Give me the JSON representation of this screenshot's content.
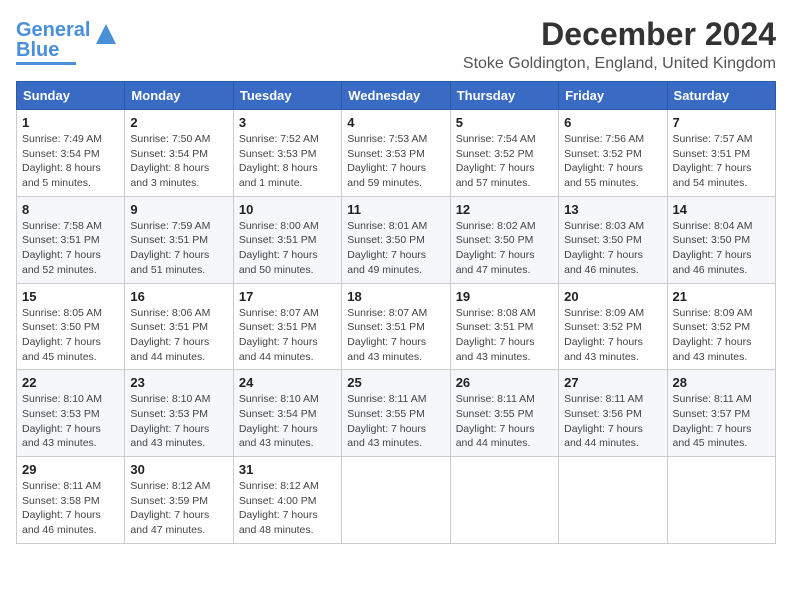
{
  "logo": {
    "part1": "General",
    "part2": "Blue"
  },
  "title": "December 2024",
  "subtitle": "Stoke Goldington, England, United Kingdom",
  "headers": [
    "Sunday",
    "Monday",
    "Tuesday",
    "Wednesday",
    "Thursday",
    "Friday",
    "Saturday"
  ],
  "weeks": [
    [
      {
        "day": "1",
        "sunrise": "Sunrise: 7:49 AM",
        "sunset": "Sunset: 3:54 PM",
        "daylight": "Daylight: 8 hours and 5 minutes."
      },
      {
        "day": "2",
        "sunrise": "Sunrise: 7:50 AM",
        "sunset": "Sunset: 3:54 PM",
        "daylight": "Daylight: 8 hours and 3 minutes."
      },
      {
        "day": "3",
        "sunrise": "Sunrise: 7:52 AM",
        "sunset": "Sunset: 3:53 PM",
        "daylight": "Daylight: 8 hours and 1 minute."
      },
      {
        "day": "4",
        "sunrise": "Sunrise: 7:53 AM",
        "sunset": "Sunset: 3:53 PM",
        "daylight": "Daylight: 7 hours and 59 minutes."
      },
      {
        "day": "5",
        "sunrise": "Sunrise: 7:54 AM",
        "sunset": "Sunset: 3:52 PM",
        "daylight": "Daylight: 7 hours and 57 minutes."
      },
      {
        "day": "6",
        "sunrise": "Sunrise: 7:56 AM",
        "sunset": "Sunset: 3:52 PM",
        "daylight": "Daylight: 7 hours and 55 minutes."
      },
      {
        "day": "7",
        "sunrise": "Sunrise: 7:57 AM",
        "sunset": "Sunset: 3:51 PM",
        "daylight": "Daylight: 7 hours and 54 minutes."
      }
    ],
    [
      {
        "day": "8",
        "sunrise": "Sunrise: 7:58 AM",
        "sunset": "Sunset: 3:51 PM",
        "daylight": "Daylight: 7 hours and 52 minutes."
      },
      {
        "day": "9",
        "sunrise": "Sunrise: 7:59 AM",
        "sunset": "Sunset: 3:51 PM",
        "daylight": "Daylight: 7 hours and 51 minutes."
      },
      {
        "day": "10",
        "sunrise": "Sunrise: 8:00 AM",
        "sunset": "Sunset: 3:51 PM",
        "daylight": "Daylight: 7 hours and 50 minutes."
      },
      {
        "day": "11",
        "sunrise": "Sunrise: 8:01 AM",
        "sunset": "Sunset: 3:50 PM",
        "daylight": "Daylight: 7 hours and 49 minutes."
      },
      {
        "day": "12",
        "sunrise": "Sunrise: 8:02 AM",
        "sunset": "Sunset: 3:50 PM",
        "daylight": "Daylight: 7 hours and 47 minutes."
      },
      {
        "day": "13",
        "sunrise": "Sunrise: 8:03 AM",
        "sunset": "Sunset: 3:50 PM",
        "daylight": "Daylight: 7 hours and 46 minutes."
      },
      {
        "day": "14",
        "sunrise": "Sunrise: 8:04 AM",
        "sunset": "Sunset: 3:50 PM",
        "daylight": "Daylight: 7 hours and 46 minutes."
      }
    ],
    [
      {
        "day": "15",
        "sunrise": "Sunrise: 8:05 AM",
        "sunset": "Sunset: 3:50 PM",
        "daylight": "Daylight: 7 hours and 45 minutes."
      },
      {
        "day": "16",
        "sunrise": "Sunrise: 8:06 AM",
        "sunset": "Sunset: 3:51 PM",
        "daylight": "Daylight: 7 hours and 44 minutes."
      },
      {
        "day": "17",
        "sunrise": "Sunrise: 8:07 AM",
        "sunset": "Sunset: 3:51 PM",
        "daylight": "Daylight: 7 hours and 44 minutes."
      },
      {
        "day": "18",
        "sunrise": "Sunrise: 8:07 AM",
        "sunset": "Sunset: 3:51 PM",
        "daylight": "Daylight: 7 hours and 43 minutes."
      },
      {
        "day": "19",
        "sunrise": "Sunrise: 8:08 AM",
        "sunset": "Sunset: 3:51 PM",
        "daylight": "Daylight: 7 hours and 43 minutes."
      },
      {
        "day": "20",
        "sunrise": "Sunrise: 8:09 AM",
        "sunset": "Sunset: 3:52 PM",
        "daylight": "Daylight: 7 hours and 43 minutes."
      },
      {
        "day": "21",
        "sunrise": "Sunrise: 8:09 AM",
        "sunset": "Sunset: 3:52 PM",
        "daylight": "Daylight: 7 hours and 43 minutes."
      }
    ],
    [
      {
        "day": "22",
        "sunrise": "Sunrise: 8:10 AM",
        "sunset": "Sunset: 3:53 PM",
        "daylight": "Daylight: 7 hours and 43 minutes."
      },
      {
        "day": "23",
        "sunrise": "Sunrise: 8:10 AM",
        "sunset": "Sunset: 3:53 PM",
        "daylight": "Daylight: 7 hours and 43 minutes."
      },
      {
        "day": "24",
        "sunrise": "Sunrise: 8:10 AM",
        "sunset": "Sunset: 3:54 PM",
        "daylight": "Daylight: 7 hours and 43 minutes."
      },
      {
        "day": "25",
        "sunrise": "Sunrise: 8:11 AM",
        "sunset": "Sunset: 3:55 PM",
        "daylight": "Daylight: 7 hours and 43 minutes."
      },
      {
        "day": "26",
        "sunrise": "Sunrise: 8:11 AM",
        "sunset": "Sunset: 3:55 PM",
        "daylight": "Daylight: 7 hours and 44 minutes."
      },
      {
        "day": "27",
        "sunrise": "Sunrise: 8:11 AM",
        "sunset": "Sunset: 3:56 PM",
        "daylight": "Daylight: 7 hours and 44 minutes."
      },
      {
        "day": "28",
        "sunrise": "Sunrise: 8:11 AM",
        "sunset": "Sunset: 3:57 PM",
        "daylight": "Daylight: 7 hours and 45 minutes."
      }
    ],
    [
      {
        "day": "29",
        "sunrise": "Sunrise: 8:11 AM",
        "sunset": "Sunset: 3:58 PM",
        "daylight": "Daylight: 7 hours and 46 minutes."
      },
      {
        "day": "30",
        "sunrise": "Sunrise: 8:12 AM",
        "sunset": "Sunset: 3:59 PM",
        "daylight": "Daylight: 7 hours and 47 minutes."
      },
      {
        "day": "31",
        "sunrise": "Sunrise: 8:12 AM",
        "sunset": "Sunset: 4:00 PM",
        "daylight": "Daylight: 7 hours and 48 minutes."
      },
      null,
      null,
      null,
      null
    ]
  ]
}
